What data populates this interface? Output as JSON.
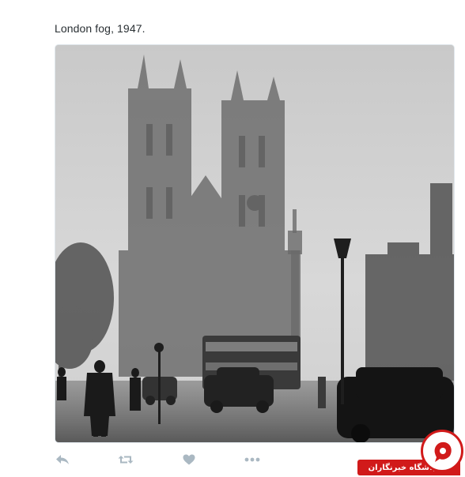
{
  "tweet": {
    "text": "London fog, 1947."
  },
  "media": {
    "alt": ""
  },
  "actions": {
    "reply_icon": "reply-icon",
    "retweet_icon": "retweet-icon",
    "like_icon": "heart-icon",
    "more_icon": "more-dots-icon"
  },
  "watermark": {
    "label": "باشگاه خبرنگاران",
    "color": "#d11a1a"
  },
  "colors": {
    "text": "#292f33",
    "action_icon": "#aab8c2"
  }
}
